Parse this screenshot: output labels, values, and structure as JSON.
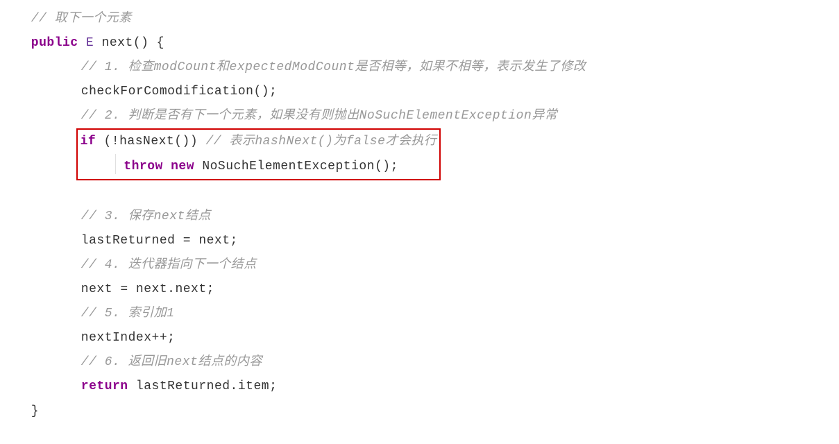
{
  "code": {
    "l1": "// 取下一个元素",
    "l2kw1": "public",
    "l2type": "E",
    "l2ident": "next",
    "l2punct1": "() {",
    "l3": "// 1. 检查modCount和expectedModCount是否相等，如果不相等，表示发生了修改",
    "l4ident": "checkForComodification",
    "l4punct": "();",
    "l5": "// 2. 判断是否有下一个元素，如果没有则抛出NoSuchElementException异常",
    "l6kw": "if",
    "l6punct1": " (!",
    "l6ident": "hasNext",
    "l6punct2": "()) ",
    "l6cm": "// 表示hashNext()为false才会执行",
    "l7kw1": "throw",
    "l7kw2": "new",
    "l7ident": " NoSuchElementException",
    "l7punct": "();",
    "l8": "// 3. 保存next结点",
    "l9a": "lastReturned",
    "l9eq": " = ",
    "l9b": "next",
    "l9semi": ";",
    "l10": "// 4. 迭代器指向下一个结点",
    "l11a": "next",
    "l11eq": " = ",
    "l11b": "next",
    "l11dot": ".",
    "l11c": "next",
    "l11semi": ";",
    "l12": "// 5. 索引加1",
    "l13a": "nextIndex",
    "l13op": "++;",
    "l14": "// 6. 返回旧next结点的内容",
    "l15kw": "return",
    "l15sp": " ",
    "l15a": "lastReturned",
    "l15dot": ".",
    "l15b": "item",
    "l15semi": ";",
    "l16": "}"
  }
}
